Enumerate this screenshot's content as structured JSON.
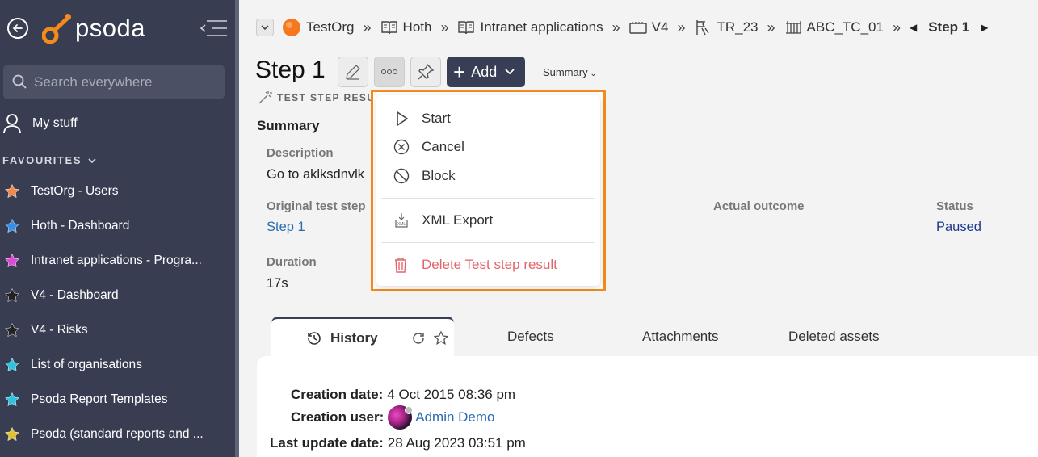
{
  "sidebar": {
    "logo_text": "psoda",
    "search_placeholder": "Search everywhere",
    "my_stuff_label": "My stuff",
    "favourites_label": "FAVOURITES",
    "favourites": [
      {
        "label": "TestOrg - Users",
        "color": "#f5894a"
      },
      {
        "label": "Hoth - Dashboard",
        "color": "#3b8ee8"
      },
      {
        "label": "Intranet applications - Progra...",
        "color": "#e04ad8"
      },
      {
        "label": "V4 - Dashboard",
        "color": "#222222"
      },
      {
        "label": "V4 - Risks",
        "color": "#222222"
      },
      {
        "label": "List of organisations",
        "color": "#2ec3e0"
      },
      {
        "label": "Psoda Report Templates",
        "color": "#2ec3e0"
      },
      {
        "label": "Psoda (standard reports and ...",
        "color": "#e3c22e"
      }
    ]
  },
  "breadcrumbs": [
    {
      "label": "TestOrg",
      "icon": "org-icon"
    },
    {
      "label": "Hoth",
      "icon": "book-icon"
    },
    {
      "label": "Intranet applications",
      "icon": "book-icon"
    },
    {
      "label": "V4",
      "icon": "ticket-icon"
    },
    {
      "label": "TR_23",
      "icon": "test-run-icon"
    },
    {
      "label": "ABC_TC_01",
      "icon": "test-case-icon"
    }
  ],
  "breadcrumb_current": "Step 1",
  "page": {
    "title": "Step 1",
    "add_label": "Add",
    "summary_dropdown": "Summary",
    "subtype": "TEST STEP RESULT",
    "section_title": "Summary"
  },
  "fields": {
    "description_label": "Description",
    "description_value": "Go to aklksdnvlk",
    "original_label": "Original test step",
    "original_value": "Step 1",
    "actual_outcome_label": "Actual outcome",
    "status_label": "Status",
    "status_value": "Paused",
    "duration_label": "Duration",
    "duration_value": "17s"
  },
  "dropdown": {
    "start": "Start",
    "cancel": "Cancel",
    "block": "Block",
    "xml_export": "XML Export",
    "delete": "Delete Test step result"
  },
  "tabs": {
    "history": "History",
    "defects": "Defects",
    "attachments": "Attachments",
    "deleted_assets": "Deleted assets"
  },
  "history": {
    "creation_date_label": "Creation date:",
    "creation_date": "4 Oct 2015 08:36 pm",
    "creation_user_label": "Creation user:",
    "creation_user": "Admin Demo",
    "last_update_label": "Last update date:",
    "last_update": "28 Aug 2023 03:51 pm"
  }
}
